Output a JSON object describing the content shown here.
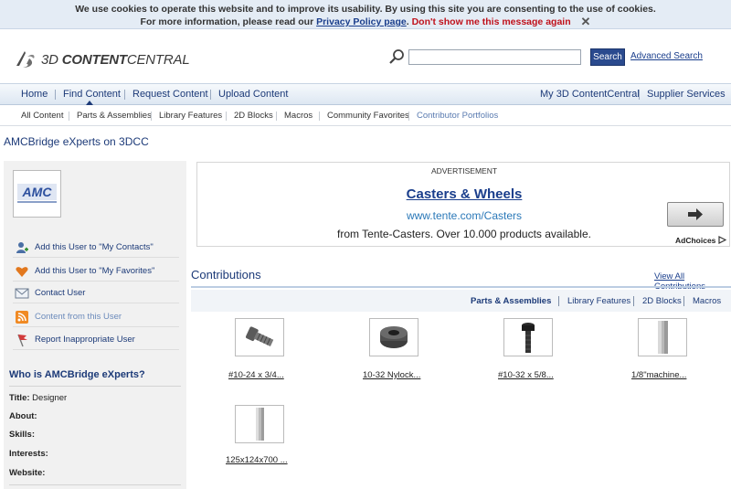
{
  "cookie_bar": {
    "line1": "We use cookies to operate this website and to improve its usability. By using this site you are consenting to the use of cookies.",
    "line2_prefix": "For more information, please read our",
    "privacy_link": "Privacy Policy page",
    "dismiss": "Don't show me this message again",
    "close": "✕"
  },
  "header": {
    "logo_prefix": "3D ",
    "logo_bold": "CONTENT",
    "logo_suffix": "CENTRAL",
    "search_placeholder": "",
    "search_button": "Search",
    "advanced_search": "Advanced Search"
  },
  "nav": {
    "left": [
      "Home",
      "Find Content",
      "Request Content",
      "Upload Content"
    ],
    "right": [
      "My 3D ContentCentral",
      "Supplier Services"
    ]
  },
  "subnav": [
    "All Content",
    "Parts & Assemblies",
    "Library Features",
    "2D Blocks",
    "Macros",
    "Community Favorites",
    "Contributor Portfolios"
  ],
  "page_title": "AMCBridge eXperts on 3DCC",
  "sidebar": {
    "avatar_text": "AMC",
    "links": [
      {
        "label": "Add this User to \"My Contacts\"",
        "icon": "contact-add-icon"
      },
      {
        "label": "Add this User to \"My Favorites\"",
        "icon": "favorite-heart-icon"
      },
      {
        "label": "Contact User",
        "icon": "envelope-icon"
      },
      {
        "label": "Content from this User",
        "icon": "rss-icon"
      },
      {
        "label": "Report Inappropriate User",
        "icon": "flag-icon"
      }
    ],
    "who_title": "Who is AMCBridge eXperts?",
    "fields": {
      "title_label": "Title:",
      "title_value": "Designer",
      "about_label": "About:",
      "skills_label": "Skills:",
      "interests_label": "Interests:",
      "website_label": "Website:"
    }
  },
  "ad": {
    "label": "ADVERTISEMENT",
    "title": "Casters & Wheels",
    "url": "www.tente.com/Casters",
    "text": "from Tente-Casters. Over 10.000 products available.",
    "choices": "AdChoices"
  },
  "contributions": {
    "title": "Contributions",
    "view_all": "View All Contributions",
    "tabs": [
      "Parts & Assemblies",
      "Library Features",
      "2D Blocks",
      "Macros"
    ],
    "items": [
      {
        "caption": "#10-24 x 3/4...",
        "icon": "screw-icon"
      },
      {
        "caption": "10-32 Nylock...",
        "icon": "nut-icon"
      },
      {
        "caption": "#10-32 x 5/8...",
        "icon": "bolt-icon"
      },
      {
        "caption": "1/8\"machine...",
        "icon": "block-icon"
      },
      {
        "caption": "125x124x700 ...",
        "icon": "bar-icon"
      }
    ]
  }
}
